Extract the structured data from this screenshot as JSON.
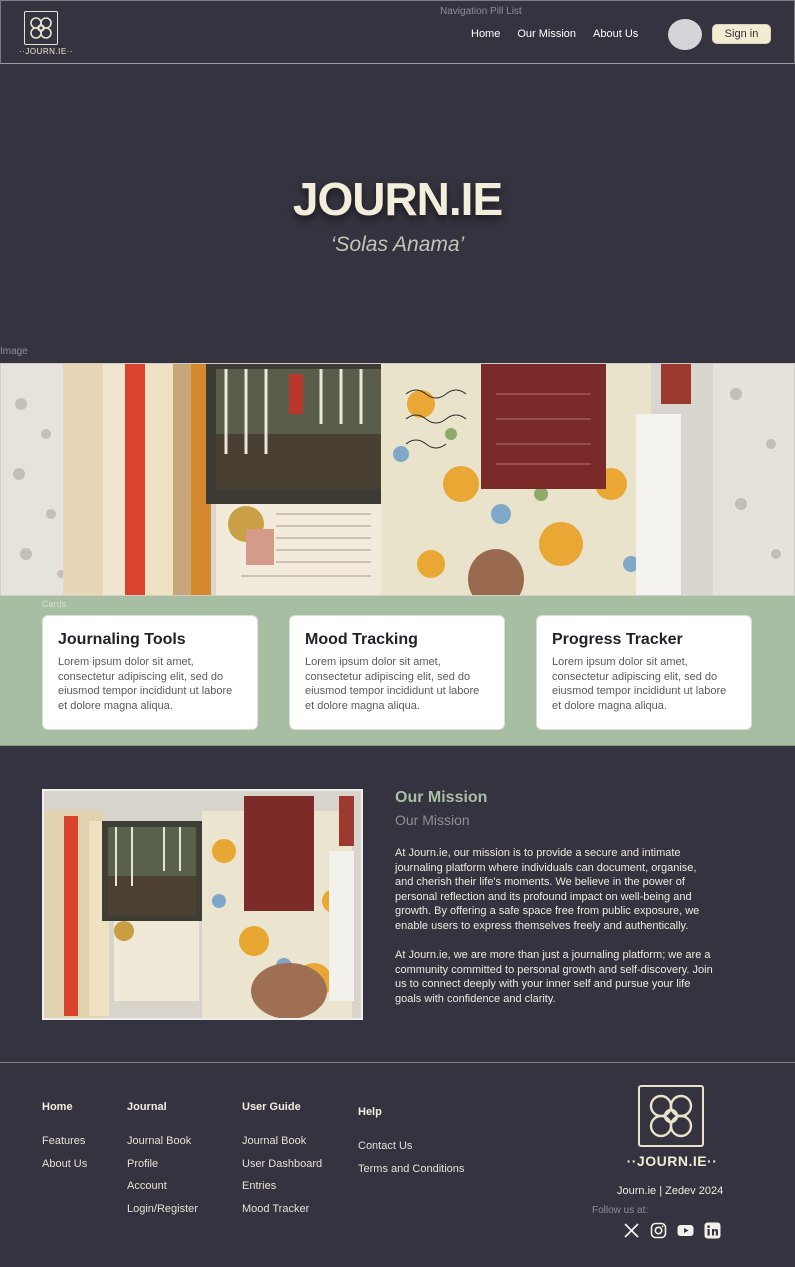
{
  "nav": {
    "caption": "Navigation Pill List",
    "logo_text": "··JOURN.IE··",
    "links": [
      "Home",
      "Our Mission",
      "About Us"
    ],
    "signin_label": "Sign in"
  },
  "hero": {
    "title": "JOURN.IE",
    "subtitle": "‘Solas Anama’"
  },
  "banner": {
    "caption": "Image"
  },
  "cards": {
    "caption": "Cards",
    "items": [
      {
        "title": "Journaling Tools",
        "body": "Lorem ipsum dolor sit amet, consectetur adipiscing elit, sed do eiusmod tempor incididunt ut labore et dolore magna aliqua."
      },
      {
        "title": "Mood Tracking",
        "body": "Lorem ipsum dolor sit amet, consectetur adipiscing elit, sed do eiusmod tempor incididunt ut labore et dolore magna aliqua."
      },
      {
        "title": "Progress Tracker",
        "body": "Lorem ipsum dolor sit amet, consectetur adipiscing elit, sed do eiusmod tempor incididunt ut labore et dolore magna aliqua."
      }
    ]
  },
  "mission": {
    "heading": "Our Mission",
    "subheading": "Our Mission",
    "paragraphs": [
      "At Journ.ie, our mission is to provide a secure and intimate journaling platform where individuals can document, organise, and cherish their life's moments. We believe in the power of personal reflection and its profound impact on well-being and growth. By offering a safe space free from public exposure, we enable users to express themselves freely and authentically.",
      "At Journ.ie, we are more than just a journaling platform; we are a community committed to personal growth and self-discovery. Join us to connect deeply with your inner self and pursue your life goals with confidence and clarity."
    ]
  },
  "footer": {
    "columns": [
      {
        "heading": "Home",
        "links": [
          "Features",
          "About Us"
        ]
      },
      {
        "heading": "Journal",
        "links": [
          "Journal Book",
          "Profile",
          "Account",
          "Login/Register"
        ]
      },
      {
        "heading": "User Guide",
        "links": [
          "Journal Book",
          "User Dashboard",
          "Entries",
          "Mood Tracker"
        ]
      },
      {
        "heading": "Help",
        "links": [
          "Contact Us",
          "Terms and Conditions"
        ]
      }
    ],
    "logo_text": "··JOURN.IE··",
    "copyright": "Journ.ie | Zedev 2024",
    "follow_label": "Follow us at:",
    "socials": [
      "x-icon",
      "instagram-icon",
      "youtube-icon",
      "linkedin-icon"
    ]
  },
  "colors": {
    "background": "#35333f",
    "sage": "#a7bea3",
    "cream": "#f1ecd2"
  }
}
